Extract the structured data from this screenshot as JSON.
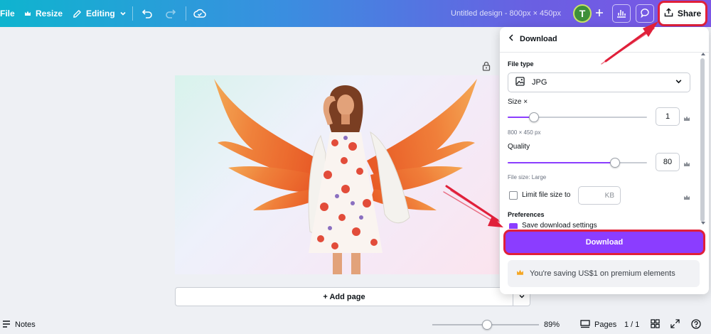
{
  "topbar": {
    "file_label": "File",
    "resize_label": "Resize",
    "editing_label": "Editing",
    "document_title": "Untitled design - 800px × 450px",
    "avatar_initial": "T",
    "share_label": "Share"
  },
  "canvas": {
    "add_page_label": "+ Add page"
  },
  "download_panel": {
    "title": "Download",
    "file_type_label": "File type",
    "file_type_value": "JPG",
    "size_label": "Size ×",
    "size_value": "1",
    "size_fraction": 0.19,
    "dimensions_note": "800 × 450 px",
    "quality_label": "Quality",
    "quality_value": "80",
    "quality_fraction": 0.77,
    "file_size_note": "File size: Large",
    "limit_label": "Limit file size to",
    "limit_unit": "KB",
    "preferences_label": "Preferences",
    "save_settings_label": "Save download settings",
    "download_button": "Download",
    "saving_note": "You're saving US$1 on premium elements"
  },
  "bottombar": {
    "notes_label": "Notes",
    "zoom_value": "89%",
    "pages_label": "Pages",
    "page_counter": "1 / 1"
  },
  "colors": {
    "accent": "#8b3dff",
    "annotation_red": "#e0203a"
  }
}
